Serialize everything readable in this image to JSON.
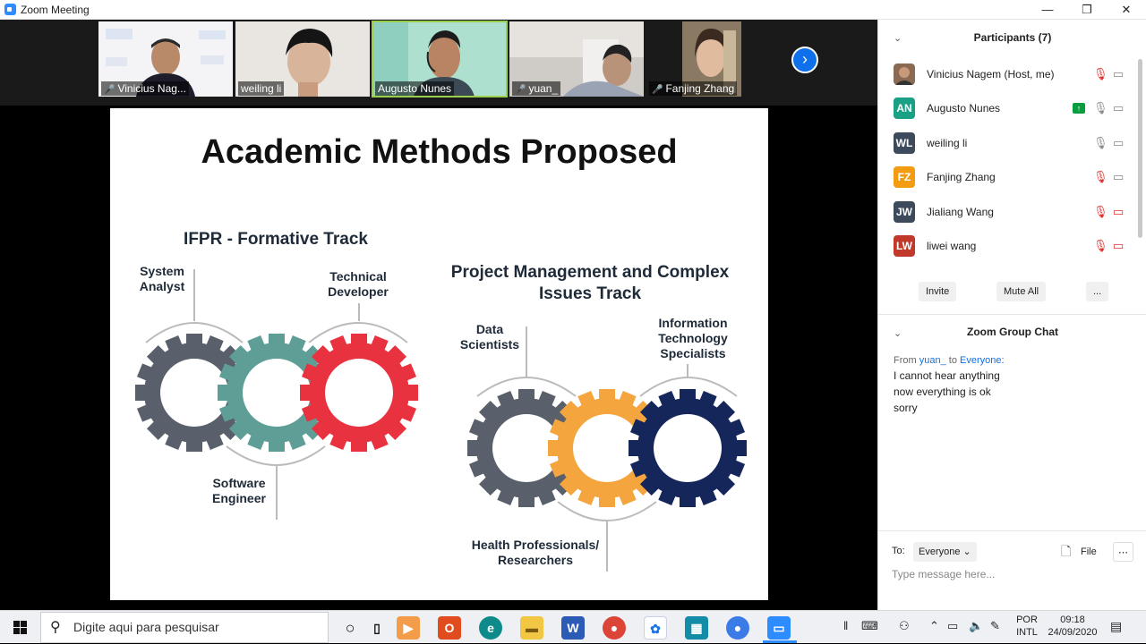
{
  "window": {
    "title": "Zoom Meeting",
    "minimize": "—",
    "maximize": "❐",
    "close": "✕"
  },
  "thumbnails": [
    {
      "name": "Vinicius Nag...",
      "muted": true
    },
    {
      "name": "weiling li",
      "muted": false
    },
    {
      "name": "Augusto Nunes",
      "muted": false,
      "active": true
    },
    {
      "name": "yuan_",
      "muted": true
    },
    {
      "name": "Fanjing Zhang",
      "muted": true
    }
  ],
  "slide": {
    "title": "Academic Methods Proposed",
    "left_heading": "IFPR - Formative Track",
    "left_roles": [
      "System Analyst",
      "Technical Developer",
      "Software Engineer"
    ],
    "right_heading": "Project Management and Complex Issues Track",
    "right_roles": [
      "Data Scientists",
      "Information Technology Specialists",
      "Health Professionals/ Researchers"
    ]
  },
  "participants": {
    "title": "Participants (7)",
    "list": [
      {
        "name": "Vinicius Nagem (Host, me)",
        "initials": "",
        "color": "#8a6a52"
      },
      {
        "name": "Augusto Nunes",
        "initials": "AN",
        "color": "#1aa085"
      },
      {
        "name": "weiling li",
        "initials": "WL",
        "color": "#3c4a5c"
      },
      {
        "name": "Fanjing Zhang",
        "initials": "FZ",
        "color": "#f39c12"
      },
      {
        "name": "Jialiang Wang",
        "initials": "JW",
        "color": "#3c4a5c"
      },
      {
        "name": "liwei wang",
        "initials": "LW",
        "color": "#c0392b"
      }
    ],
    "invite": "Invite",
    "mute_all": "Mute All",
    "more": "..."
  },
  "chat": {
    "title": "Zoom Group Chat",
    "from_label": "From",
    "from_user": "yuan_",
    "to_label": "to",
    "to_user": "Everyone:",
    "messages": [
      "I cannot hear anything",
      "now everything is ok",
      "sorry"
    ],
    "to_prefix": "To:",
    "recipient": "Everyone",
    "file": "File",
    "placeholder": "Type message here..."
  },
  "taskbar": {
    "search_placeholder": "Digite aqui para pesquisar",
    "lang_top": "POR",
    "lang_bottom": "INTL",
    "time": "09:18",
    "date": "24/09/2020"
  }
}
